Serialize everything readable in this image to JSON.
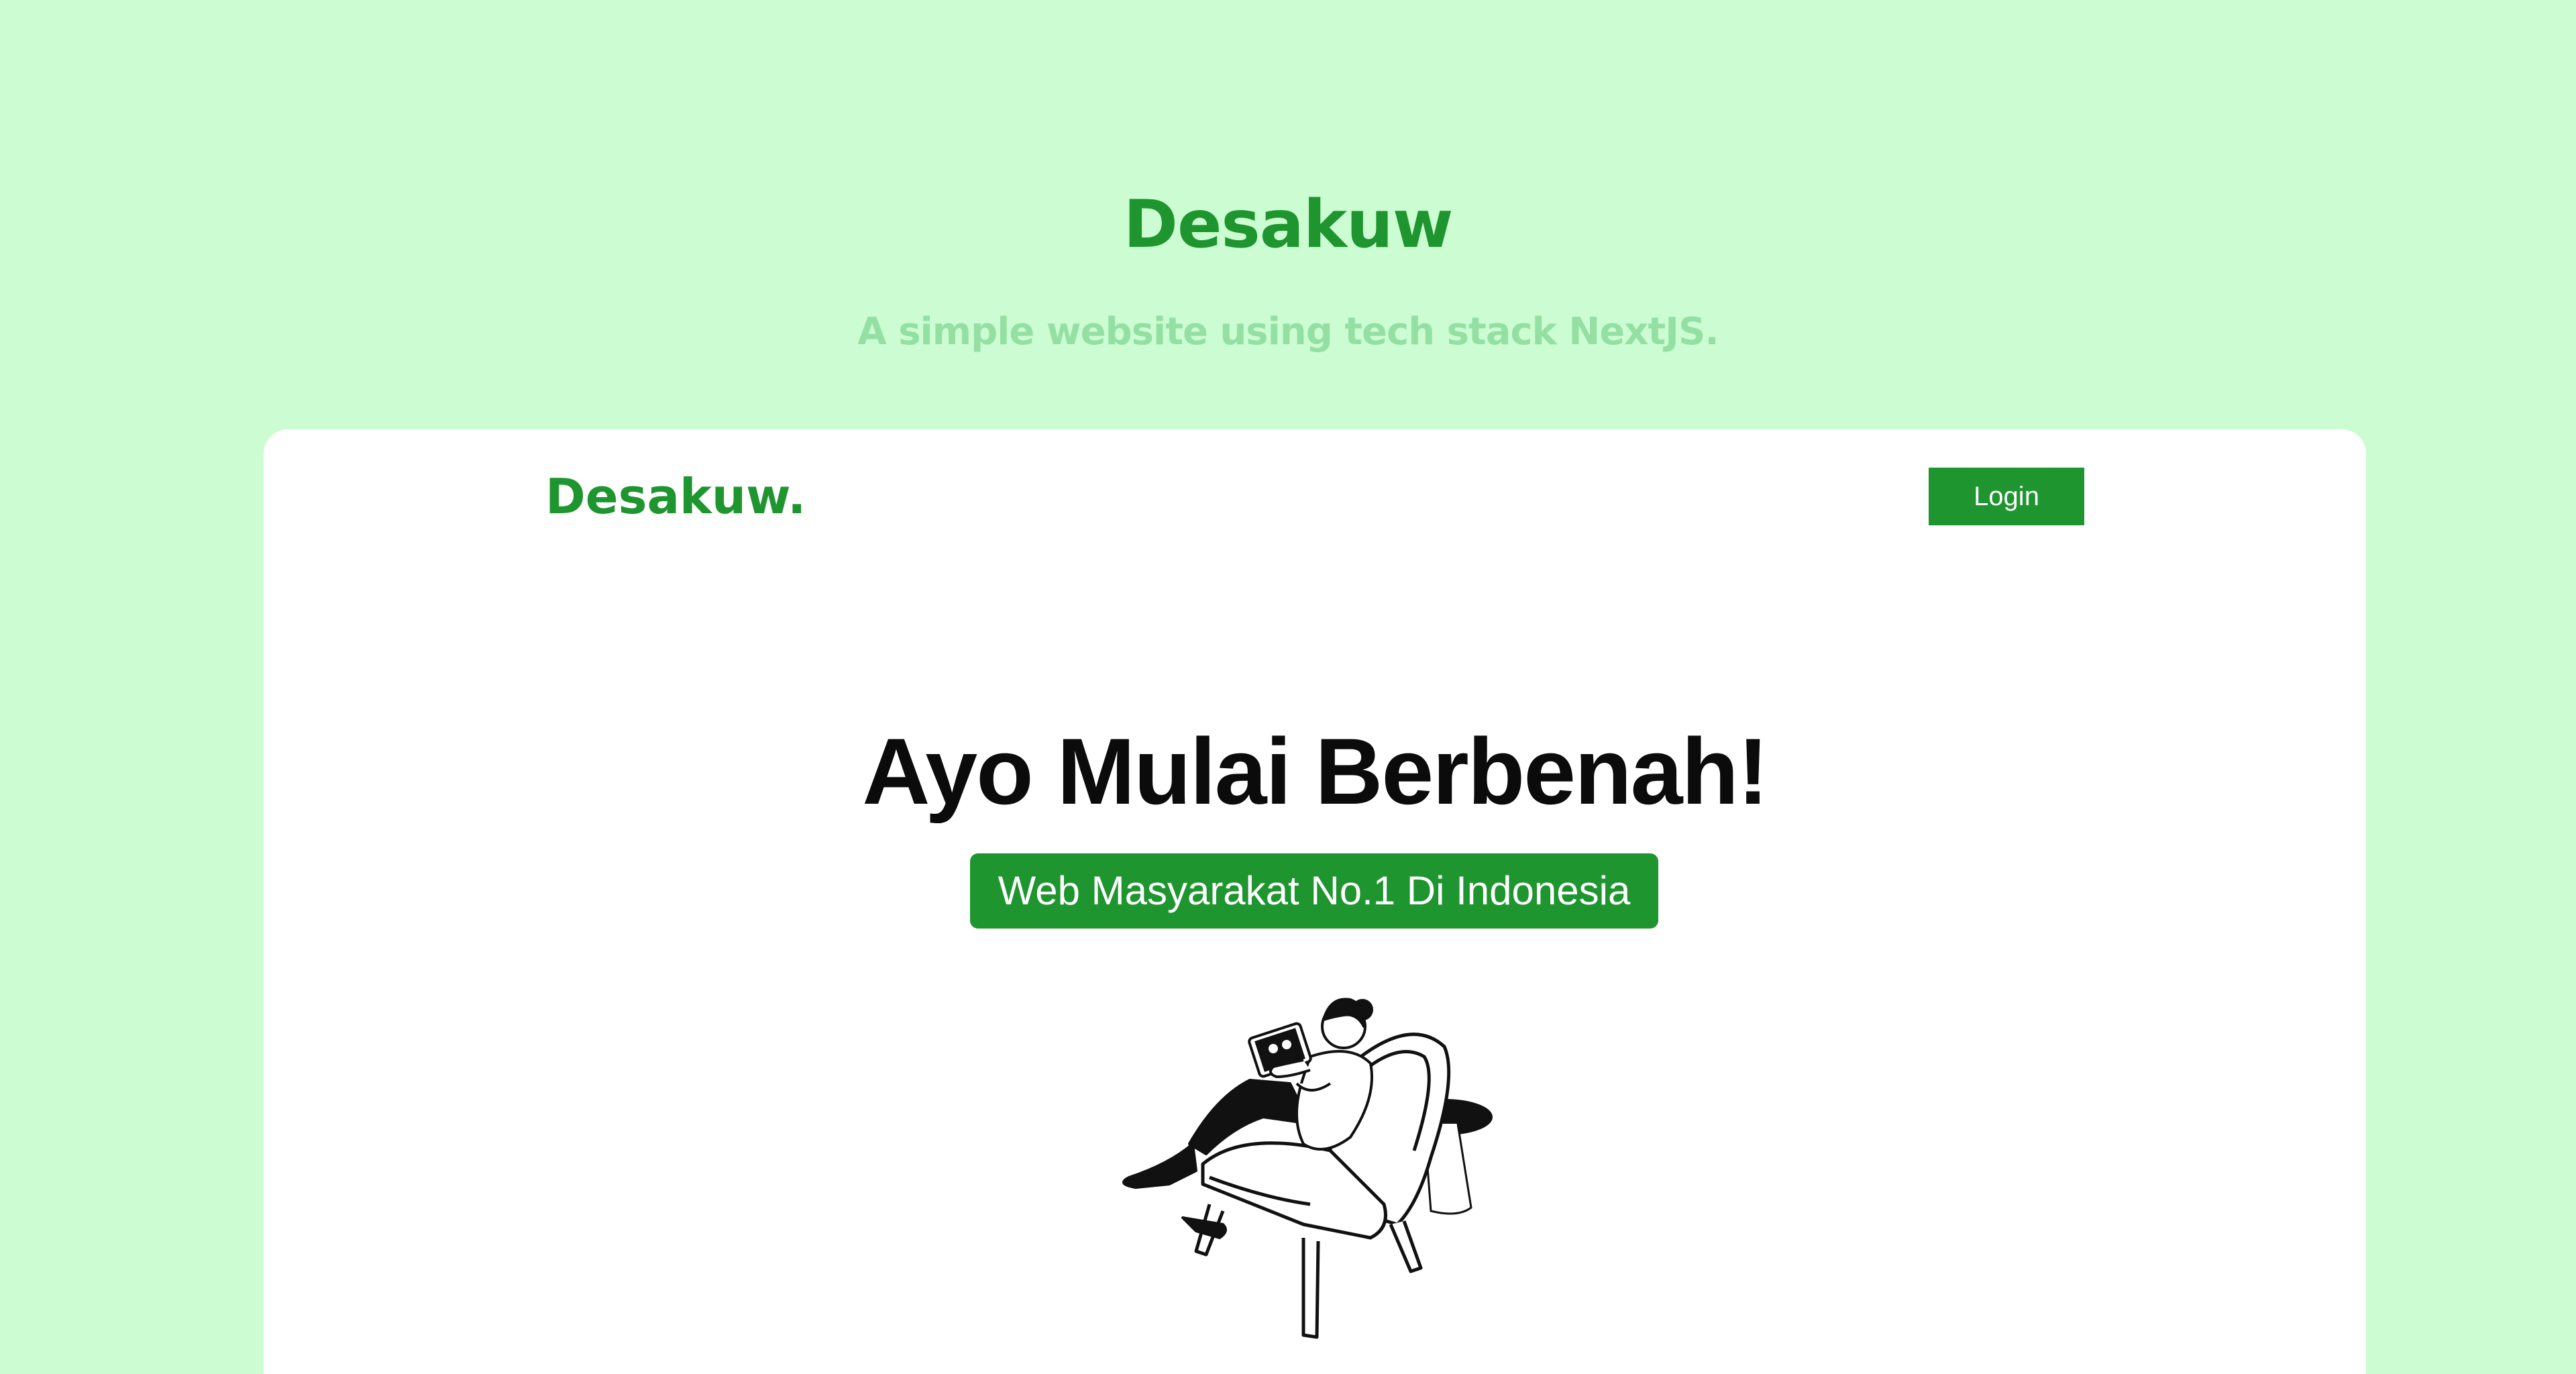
{
  "header": {
    "title": "Desakuw",
    "subtitle": "A simple website using tech stack NextJS."
  },
  "preview": {
    "brand": "Desakuw.",
    "login_label": "Login",
    "heading": "Ayo Mulai Berbenah!",
    "tagline": "Web Masyarakat No.1 Di Indonesia",
    "illustration": "person-reading-tablet-in-armchair"
  },
  "colors": {
    "background": "#ccfdd2",
    "brand_green": "#1e952e",
    "subtitle_green": "#94dfa4",
    "card": "#ffffff",
    "heading": "#0b0b0b"
  }
}
